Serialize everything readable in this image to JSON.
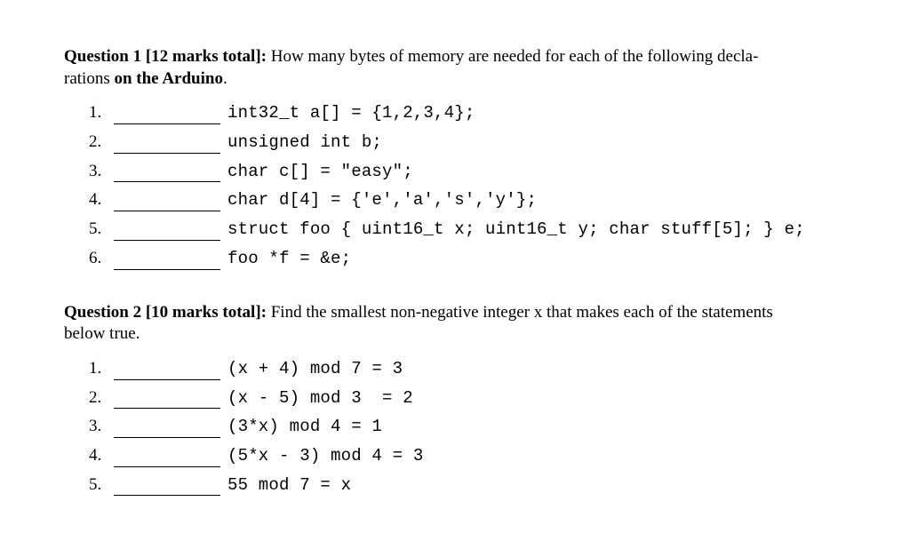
{
  "q1": {
    "label_part1": "Question 1 [12 marks total]:",
    "text_part1": " How many bytes of memory are needed for each of the following decla-",
    "text_line2a": "rations ",
    "bold_mid": "on the Arduino",
    "text_line2b": ".",
    "items": [
      {
        "n": "1.",
        "code": "int32_t a[] = {1,2,3,4};"
      },
      {
        "n": "2.",
        "code": "unsigned int b;"
      },
      {
        "n": "3.",
        "code": "char c[] = \"easy\";"
      },
      {
        "n": "4.",
        "code": "char d[4] = {'e','a','s','y'};"
      },
      {
        "n": "5.",
        "code": "struct foo { uint16_t x; uint16_t y; char stuff[5]; } e;"
      },
      {
        "n": "6.",
        "code": "foo *f = &e;"
      }
    ]
  },
  "q2": {
    "label_part1": "Question 2 [10 marks total]:",
    "text_part1": " Find the smallest non-negative integer x that makes each of the statements",
    "text_line2": "below true.",
    "items": [
      {
        "n": "1.",
        "code": "(x + 4) mod 7 = 3"
      },
      {
        "n": "2.",
        "code": "(x - 5) mod 3  = 2"
      },
      {
        "n": "3.",
        "code": "(3*x) mod 4 = 1"
      },
      {
        "n": "4.",
        "code": "(5*x - 3) mod 4 = 3"
      },
      {
        "n": "5.",
        "code": "55 mod 7 = x"
      }
    ]
  }
}
